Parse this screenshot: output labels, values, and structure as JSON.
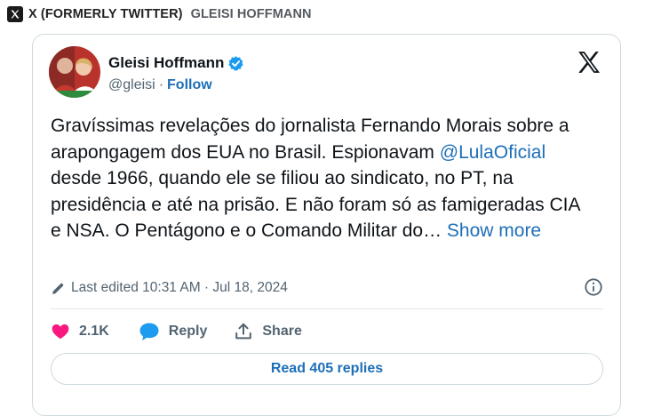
{
  "source": {
    "platform": "X (FORMERLY TWITTER)",
    "author": "GLEISI HOFFMANN",
    "logo_icon": "x-logo-icon"
  },
  "tweet": {
    "author_name": "Gleisi Hoffmann",
    "handle": "@gleisi",
    "separator": "·",
    "follow_label": "Follow",
    "verified_icon": "verified-badge-icon",
    "text_part1": "Gravíssimas revelações do jornalista Fernando Morais sobre a arapongagem dos EUA no Brasil. Espionavam ",
    "mention": "@LulaOficial",
    "text_part2": " desde 1966, quando ele se filiou ao sindicato, no PT, na presidência e até na prisão. E não foram só as famigeradas CIA e NSA. O Pentágono e o Comando Militar do… ",
    "show_more": "Show more",
    "edited_label": "Last edited 10:31 AM · Jul 18, 2024"
  },
  "actions": {
    "likes_count": "2.1K",
    "reply_label": "Reply",
    "share_label": "Share"
  },
  "read_replies_label": "Read 405 replies",
  "colors": {
    "link": "#1d6fb8",
    "verified": "#1d9bf0",
    "heart": "#f91880",
    "secondary_text": "#536471",
    "border": "#cfd9de"
  }
}
